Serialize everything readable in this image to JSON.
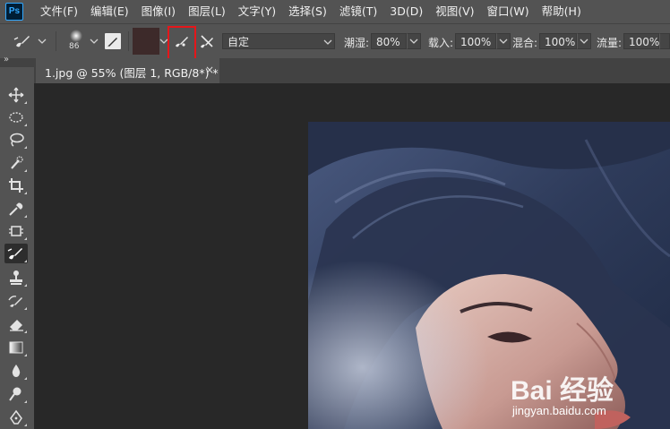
{
  "app": {
    "logo_text": "Ps"
  },
  "menu": [
    "文件(F)",
    "编辑(E)",
    "图像(I)",
    "图层(L)",
    "文字(Y)",
    "选择(S)",
    "滤镜(T)",
    "3D(D)",
    "视图(V)",
    "窗口(W)",
    "帮助(H)"
  ],
  "options": {
    "brush_size": "86",
    "mode_value": "自定",
    "exposure_label": "潮湿:",
    "exposure_value": "80%",
    "load_label": "载入:",
    "load_value": "100%",
    "mix_label": "混合:",
    "mix_value": "100%",
    "flow_label": "流量:",
    "flow_value": "100%",
    "foreground_color": "#3d2a2a",
    "highlight_color": "#e5161a"
  },
  "panel": {
    "collapse_label": "»"
  },
  "document": {
    "tab_label": "1.jpg @ 55% (图层 1, RGB/8*) *",
    "close_glyph": "×"
  },
  "watermark": {
    "brand": "Bai 经验",
    "url": "jingyan.baidu.com"
  },
  "tools": [
    "move-tool-icon",
    "marquee-tool-icon",
    "lasso-tool-icon",
    "quick-select-tool-icon",
    "crop-tool-icon",
    "eyedropper-tool-icon",
    "frame-tool-icon",
    "mixer-brush-tool-icon",
    "stamp-tool-icon",
    "history-brush-tool-icon",
    "eraser-tool-icon",
    "gradient-tool-icon",
    "blur-tool-icon",
    "dodge-tool-icon",
    "pen-tool-icon"
  ]
}
